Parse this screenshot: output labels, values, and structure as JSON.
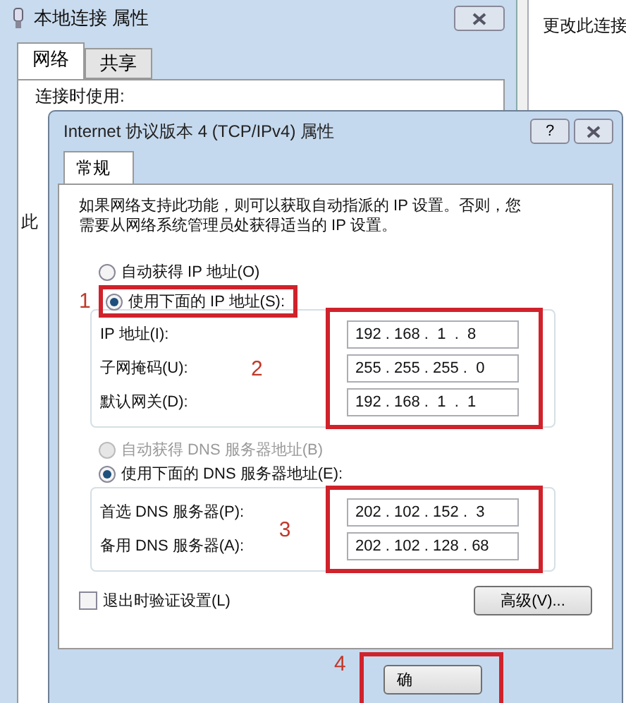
{
  "back_window": {
    "title": "本地连接 属性",
    "tabs": [
      {
        "label": "网络",
        "selected": true
      },
      {
        "label": "共享",
        "selected": false
      }
    ],
    "label": "连接时使用:",
    "label_2": "此"
  },
  "right_window": {
    "text": "更改此连接"
  },
  "dialog": {
    "title": "Internet 协议版本 4 (TCP/IPv4) 属性",
    "help": "?",
    "tabs": [
      {
        "label": "常规",
        "selected": true
      }
    ],
    "description": "如果网络支持此功能，则可以获取自动指派的 IP 设置。否则，您需要从网络系统管理员处获得适当的 IP 设置。",
    "ip_mode": [
      {
        "label": "自动获得 IP 地址(O)",
        "selected": false,
        "disabled": false
      },
      {
        "label": "使用下面的 IP 地址(S):",
        "selected": true,
        "disabled": false
      }
    ],
    "ip_fields": [
      {
        "label": "IP 地址(I):",
        "value": "192 . 168 .  1  .  8"
      },
      {
        "label": "子网掩码(U):",
        "value": "255 . 255 . 255 .  0"
      },
      {
        "label": "默认网关(D):",
        "value": "192 . 168 .  1  .  1"
      }
    ],
    "dns_mode": [
      {
        "label": "自动获得 DNS 服务器地址(B)",
        "selected": false,
        "disabled": true
      },
      {
        "label": "使用下面的 DNS 服务器地址(E):",
        "selected": true,
        "disabled": false
      }
    ],
    "dns_fields": [
      {
        "label": "首选 DNS 服务器(P):",
        "value": "202 . 102 . 152 .  3"
      },
      {
        "label": "备用 DNS 服务器(A):",
        "value": "202 . 102 . 128 . 68"
      }
    ],
    "validate": {
      "label": "退出时验证设置(L)",
      "checked": false
    },
    "advanced_button": "高级(V)...",
    "ok_button": "确"
  },
  "annotations": [
    "1",
    "2",
    "3",
    "4"
  ]
}
